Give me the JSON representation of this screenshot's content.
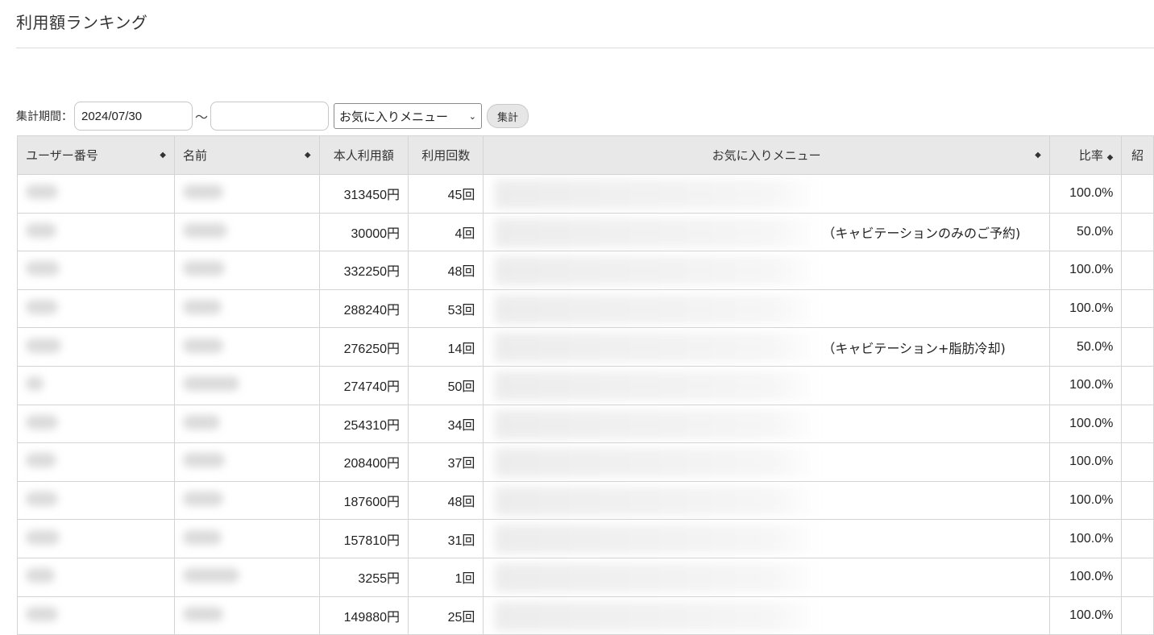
{
  "page": {
    "title": "利用額ランキング"
  },
  "filter": {
    "label": "集計期間：",
    "start_date": "2024/07/30",
    "separator": "〜",
    "end_date": "",
    "menu_select": "お気に入りメニュー",
    "submit_label": "集計"
  },
  "table": {
    "headers": [
      "ユーザー番号",
      "名前",
      "本人利用額",
      "利用回数",
      "お気に入りメニュー",
      "比率",
      "紹"
    ],
    "rows": [
      {
        "amount": "313450円",
        "count": "45回",
        "menu": "",
        "ratio": "100.0%"
      },
      {
        "amount": "30000円",
        "count": "4回",
        "menu": "（キャビテーションのみのご予約)",
        "ratio": "50.0%"
      },
      {
        "amount": "332250円",
        "count": "48回",
        "menu": "",
        "ratio": "100.0%"
      },
      {
        "amount": "288240円",
        "count": "53回",
        "menu": "",
        "ratio": "100.0%"
      },
      {
        "amount": "276250円",
        "count": "14回",
        "menu": "（キャビテーション+脂肪冷却)",
        "ratio": "50.0%"
      },
      {
        "amount": "274740円",
        "count": "50回",
        "menu": "",
        "ratio": "100.0%"
      },
      {
        "amount": "254310円",
        "count": "34回",
        "menu": "",
        "ratio": "100.0%"
      },
      {
        "amount": "208400円",
        "count": "37回",
        "menu": "",
        "ratio": "100.0%"
      },
      {
        "amount": "187600円",
        "count": "48回",
        "menu": "",
        "ratio": "100.0%"
      },
      {
        "amount": "157810円",
        "count": "31回",
        "menu": "",
        "ratio": "100.0%"
      },
      {
        "amount": "3255円",
        "count": "1回",
        "menu": "",
        "ratio": "100.0%"
      },
      {
        "amount": "149880円",
        "count": "25回",
        "menu": "",
        "ratio": "100.0%"
      }
    ]
  },
  "icons": {
    "sort": "sort-icon",
    "dropdown": "chevron-down-icon"
  }
}
